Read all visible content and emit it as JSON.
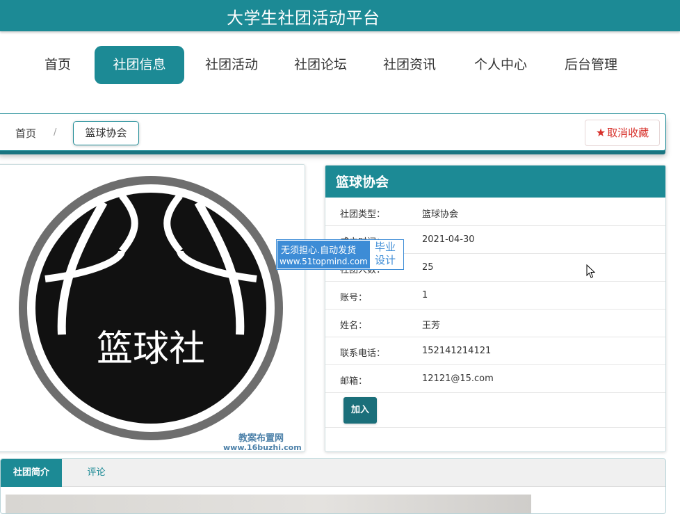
{
  "header": {
    "site_title": "大学生社团活动平台"
  },
  "nav": {
    "items": [
      {
        "label": "首页"
      },
      {
        "label": "社团信息"
      },
      {
        "label": "社团活动"
      },
      {
        "label": "社团论坛"
      },
      {
        "label": "社团资讯"
      },
      {
        "label": "个人中心"
      },
      {
        "label": "后台管理"
      }
    ],
    "active_index": 1
  },
  "breadcrumb": {
    "home": "首页",
    "separator": "/",
    "current": "篮球协会"
  },
  "favorite_button": {
    "label": "取消收藏",
    "icon": "star-icon"
  },
  "club_image": {
    "text": "篮球社",
    "watermark_name": "教案布置网",
    "watermark_url": "www.16buzhi.com"
  },
  "info": {
    "title": "篮球协会",
    "rows": [
      {
        "key": "社团类型：",
        "value": "篮球协会"
      },
      {
        "key": "成立时间：",
        "value": "2021-04-30"
      },
      {
        "key": "社团人数：",
        "value": "25"
      },
      {
        "key": "账号：",
        "value": "1"
      },
      {
        "key": "姓名：",
        "value": "王芳"
      },
      {
        "key": "联系电话：",
        "value": "152141214121"
      },
      {
        "key": "邮箱：",
        "value": "12121@15.com"
      }
    ],
    "join_label": "加入"
  },
  "overlay_ad": {
    "line1": "无须担心.自动发货",
    "line2": "www.51topmind.com",
    "right_line1": "毕业",
    "right_line2": "设计"
  },
  "tabs": [
    {
      "label": "社团简介"
    },
    {
      "label": "评论"
    }
  ],
  "colors": {
    "primary": "#1c8a95",
    "danger": "#d7302a",
    "ad_blue": "#3d8cd6"
  }
}
